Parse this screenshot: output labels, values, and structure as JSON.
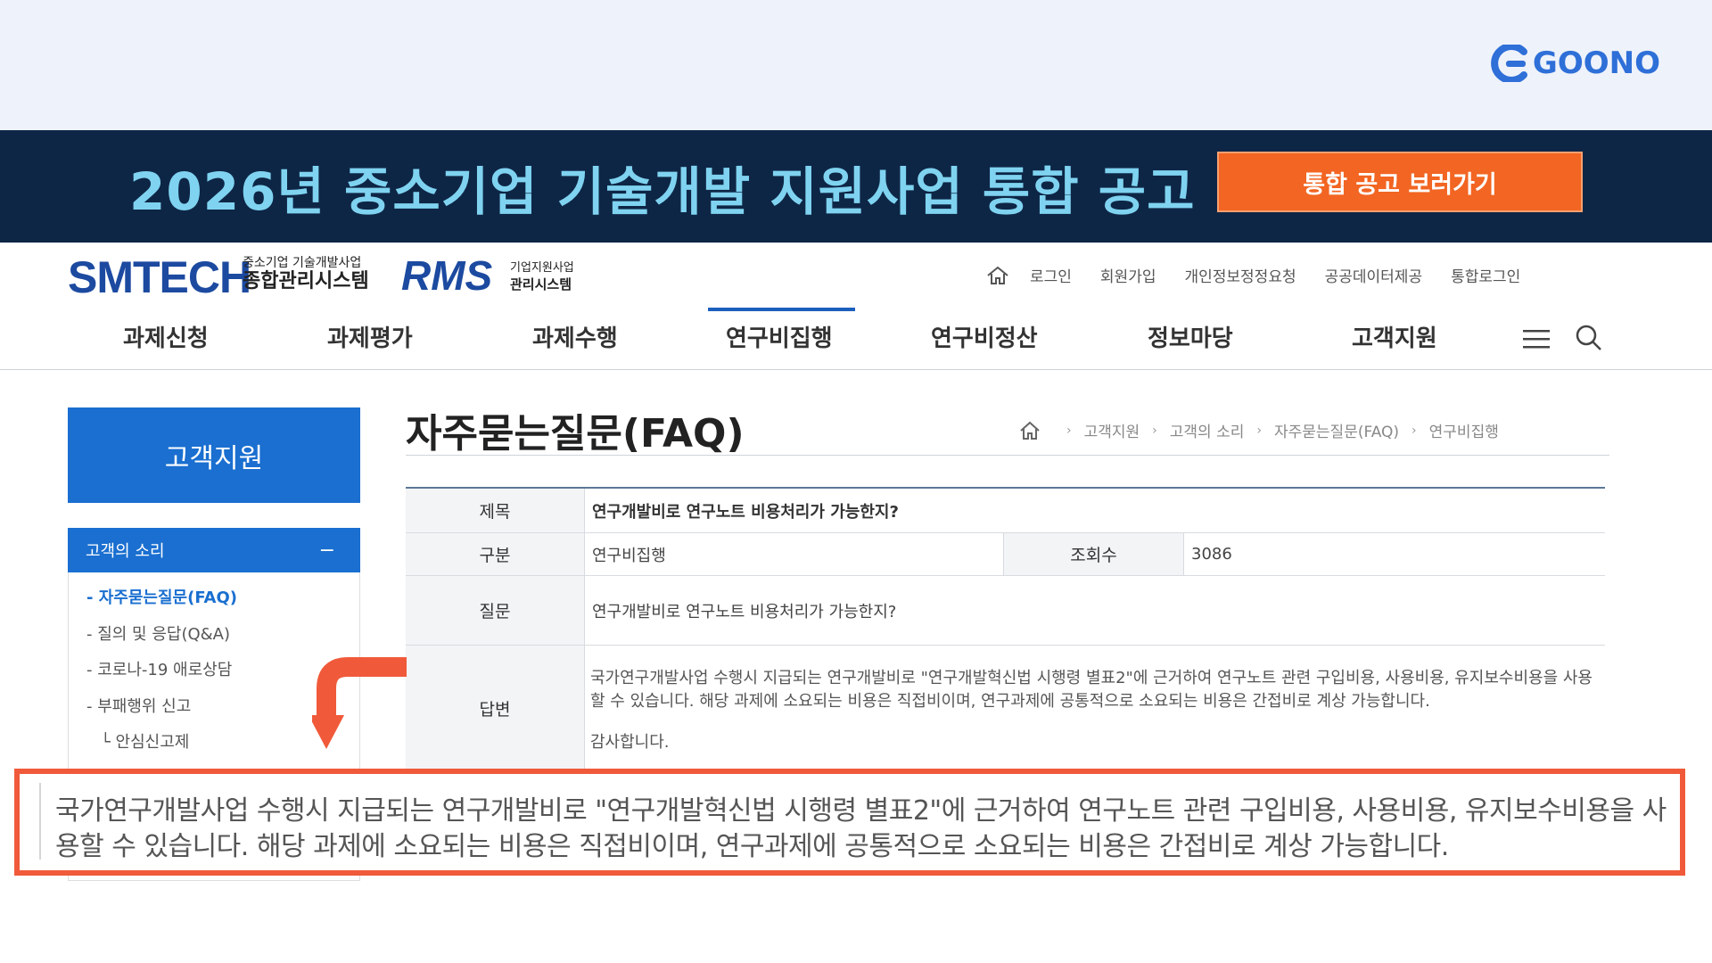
{
  "brand": {
    "goono_label": "GOONO",
    "accent": "#2e6fd8"
  },
  "banner": {
    "title": "2026년 중소기업 기술개발 지원사업 통합 공고",
    "button_label": "통합 공고 보러가기",
    "bg_color": "#0e2646",
    "button_color": "#f26522"
  },
  "header": {
    "smtech": "SMTECH",
    "smtech_sub_small": "중소기업 기술개발사업",
    "smtech_sub_big": "종합관리시스템",
    "rms": "RMS",
    "rms_sub_small": "기업지원사업",
    "rms_sub_big": "관리시스템",
    "util_links": [
      "로그인",
      "회원가입",
      "개인정보정정요청",
      "공공데이터제공",
      "통합로그인"
    ]
  },
  "gnb": {
    "items": [
      "과제신청",
      "과제평가",
      "과제수행",
      "연구비집행",
      "연구비정산",
      "정보마당",
      "고객지원"
    ],
    "active": "연구비집행"
  },
  "sidebar": {
    "title": "고객지원",
    "section": "고객의 소리",
    "section_toggle": "−",
    "items": [
      "- 자주묻는질문(FAQ)",
      "- 질의 및 응답(Q&A)",
      "- 코로나-19 애로상담",
      "- 부패행위 신고",
      "└ 안심신고제"
    ]
  },
  "page": {
    "title": "자주묻는질문(FAQ)",
    "breadcrumb": [
      "고객지원",
      "고객의 소리",
      "자주묻는질문(FAQ)",
      "연구비집행"
    ],
    "breadcrumb_sep": "›"
  },
  "faq": {
    "subject_label": "제목",
    "subject": "연구개발비로 연구노트 비용처리가 가능한지?",
    "category_label": "구분",
    "category": "연구비집행",
    "views_label": "조회수",
    "views": "3086",
    "question_label": "질문",
    "question": "연구개발비로 연구노트 비용처리가 가능한지?",
    "answer_label": "답변",
    "answer": "국가연구개발사업 수행시 지급되는 연구개발비로 \"연구개발혁신법 시행령 별표2\"에 근거하여 연구노트 관련 구입비용, 사용비용, 유지보수비용을 사용할 수 있습니다. 해당 과제에 소요되는 비용은 직접비이며, 연구과제에 공통적으로 소요되는 비용은 간접비로 계상 가능합니다.",
    "thanks": "감사합니다."
  },
  "callout": {
    "text": "국가연구개발사업 수행시 지급되는 연구개발비로 \"연구개발혁신법 시행령 별표2\"에 근거하여 연구노트 관련 구입비용, 사용비용, 유지보수비용을 사용할 수 있습니다. 해당 과제에 소요되는 비용은 직접비이며, 연구과제에 공통적으로 소요되는 비용은 간접비로 계상 가능합니다.",
    "border_color": "#f05a3a"
  }
}
